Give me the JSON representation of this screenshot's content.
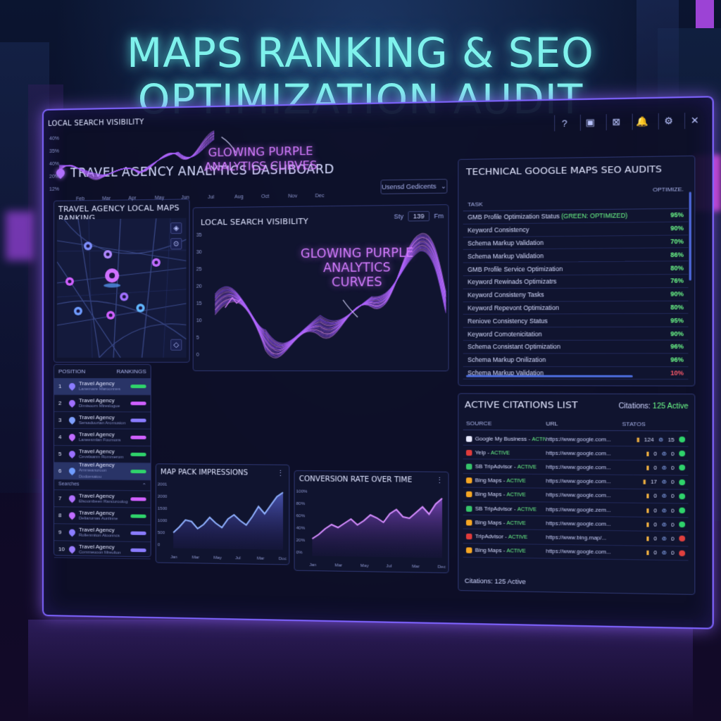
{
  "headline": [
    "MAPS RANKING & SEO",
    "OPTIMIZATION AUDIT"
  ],
  "toolbar": {
    "icons": [
      "help-icon",
      "book-icon",
      "edit-icon",
      "bell-icon",
      "gear-icon",
      "close-icon"
    ],
    "glyphs": [
      "?",
      "▣",
      "⊠",
      "🔔",
      "⚙",
      "✕"
    ]
  },
  "dashboard": {
    "title": "TRAVEL AGENCY ANALYTICS DASHBOARD",
    "dropdown": "Usensd Gedicents"
  },
  "maps_panel": {
    "title": "TRAVEL AGENCY LOCAL MAPS RANKING"
  },
  "lsv_top": {
    "title": "LOCAL SEARCH VISIBILITY",
    "range_prefix": "Sty",
    "range_value": "139",
    "range_suffix": "Fm",
    "y_ticks": [
      "35",
      "30",
      "25",
      "20",
      "15",
      "10",
      "5",
      "0"
    ],
    "annotation": [
      "GLOWING PURPLE",
      "ANALYTICS",
      "CURVES"
    ]
  },
  "ranking": {
    "col_position": "POSITION",
    "col_rankings": "RANKINGS",
    "divider": "Searches",
    "rows": [
      {
        "num": "1",
        "name": "Travel Agency",
        "sub": "Lanemare Maroonnes",
        "bar": "#2fd36b",
        "pin": "#8a7cff"
      },
      {
        "num": "2",
        "name": "Travel Agency",
        "sub": "Dimisoorn Mireslogue",
        "bar": "#d060ff",
        "pin": "#a070ff"
      },
      {
        "num": "3",
        "name": "Travel Agency",
        "sub": "Sersaduurtan Aromusion",
        "bar": "#8a7cff",
        "pin": "#7fa0ff"
      },
      {
        "num": "4",
        "name": "Travel Agency",
        "sub": "Laneesmlan Foumons",
        "bar": "#d060ff",
        "pin": "#c06cff"
      },
      {
        "num": "5",
        "name": "Travel Agency",
        "sub": "Cevelaanm Rommerom",
        "bar": "#2fd36b",
        "pin": "#9a70ff"
      },
      {
        "num": "6",
        "name": "Travel Agency",
        "sub": "Ammeanuroon Dodoesaiou",
        "bar": "#2fd36b",
        "pin": "#6f9cff"
      },
      {
        "num": "7",
        "name": "Travel Agency",
        "sub": "Elsoombeen Rancuroolog",
        "bar": "#d060ff",
        "pin": "#b070ff"
      },
      {
        "num": "8",
        "name": "Travel Agency",
        "sub": "Deliarumas Aunlinne",
        "bar": "#2fd36b",
        "pin": "#c06cff"
      },
      {
        "num": "9",
        "name": "Travel Agency",
        "sub": "Rollenmiton Aloonncs",
        "bar": "#8a7cff",
        "pin": "#8a7cff"
      },
      {
        "num": "10",
        "name": "Travel Agency",
        "sub": "Commeuoon Mreulton",
        "bar": "#8a7cff",
        "pin": "#9a7cff"
      }
    ]
  },
  "lsv_bottom": {
    "title": "LOCAL SEARCH VISIBILITY",
    "y_ticks": [
      "40%",
      "35%",
      "40%",
      "20%",
      "12%"
    ],
    "months": [
      "Feb",
      "Mar",
      "Apr",
      "May",
      "Jun",
      "Jul",
      "Aug",
      "Oct",
      "Nov",
      "Dec"
    ],
    "annotation": [
      "GLOWING PURPLE",
      "ANALYTICS CURVES"
    ]
  },
  "map_pack": {
    "title": "MAP PACK IMPRESSIONS",
    "y_ticks": [
      "2001",
      "2000",
      "1500",
      "1000",
      "500",
      "0"
    ],
    "months": [
      "Jan",
      "Mar",
      "May",
      "Jul",
      "Mar",
      "Doc"
    ]
  },
  "conversion": {
    "title": "CONVERSION RATE OVER TIME",
    "y_ticks": [
      "100%",
      "80%",
      "60%",
      "40%",
      "20%",
      "0%"
    ],
    "months": [
      "Jan",
      "Mar",
      "May",
      "Jul",
      "Mar",
      "Dec"
    ]
  },
  "audit": {
    "title": "TECHNICAL GOOGLE MAPS SEO AUDITS",
    "col_optimize": "OPTIMIZE.",
    "col_task": "TASK",
    "rows": [
      {
        "task": "GMB Profile Optimization Status",
        "tag": "(GREEN: OPTIMIZED)",
        "pct": "95%"
      },
      {
        "task": "Keyword Consistency",
        "tag": "",
        "pct": "90%"
      },
      {
        "task": "Schema Markup Validation",
        "tag": "",
        "pct": "70%"
      },
      {
        "task": "Schema Markup Validation",
        "tag": "",
        "pct": "86%"
      },
      {
        "task": "GMB Profile Service Optimization",
        "tag": "",
        "pct": "80%"
      },
      {
        "task": "Keyword Rewinads Optimizatrs",
        "tag": "",
        "pct": "76%"
      },
      {
        "task": "Keyword Consisteny Tasks",
        "tag": "",
        "pct": "90%"
      },
      {
        "task": "Keyword Repevont Optimization",
        "tag": "",
        "pct": "80%"
      },
      {
        "task": "Reniove Consistency Status",
        "tag": "",
        "pct": "95%"
      },
      {
        "task": "Keyword Comotenicitation",
        "tag": "",
        "pct": "90%"
      },
      {
        "task": "Schema Consistant Optimization",
        "tag": "",
        "pct": "96%"
      },
      {
        "task": "Schema Markup Onilization",
        "tag": "",
        "pct": "96%"
      },
      {
        "task": "Schema Markup Validation",
        "tag": "",
        "pct": "10%"
      }
    ]
  },
  "citations": {
    "title": "ACTIVE CITATIONS LIST",
    "count_label": "Citations:",
    "count_value": "125 Active",
    "col_source": "SOURCE",
    "col_url": "URL",
    "col_status": "STATOS",
    "footer": "Citations: 125 Active",
    "rows": [
      {
        "src": "Google My Business",
        "act": "ACTIVE",
        "url": "https://www.google.com...",
        "a": "124",
        "b": "15",
        "ok": true,
        "logo": "#e8eaff"
      },
      {
        "src": "Yelp",
        "act": "ACTIVE",
        "url": "https://www.google.com...",
        "a": "0",
        "b": "0",
        "ok": true,
        "logo": "#e03b3b"
      },
      {
        "src": "SB TripAdvisor",
        "act": "ACTIVE",
        "url": "https://www.google.com...",
        "a": "0",
        "b": "0",
        "ok": true,
        "logo": "#35c36a"
      },
      {
        "src": "Bing Maps",
        "act": "ACTIVE",
        "url": "https://www.google.com...",
        "a": "17",
        "b": "0",
        "ok": true,
        "logo": "#f5a623"
      },
      {
        "src": "Bing Maps",
        "act": "ACTIVE",
        "url": "https://www.google.com...",
        "a": "0",
        "b": "0",
        "ok": true,
        "logo": "#f5a623"
      },
      {
        "src": "SB TripAdvisor",
        "act": "ACTIVE",
        "url": "https://www.google.zem...",
        "a": "0",
        "b": "0",
        "ok": true,
        "logo": "#35c36a"
      },
      {
        "src": "Bing Maps",
        "act": "ACTIVE",
        "url": "https://www.google.com...",
        "a": "0",
        "b": "0",
        "ok": true,
        "logo": "#f5a623"
      },
      {
        "src": "TripAdvisor",
        "act": "ACTIVE",
        "url": "https://www.bing.map/...",
        "a": "0",
        "b": "0",
        "ok": false,
        "logo": "#e03b3b"
      },
      {
        "src": "Bing Maps",
        "act": "ACTIVE",
        "url": "https://www.google.com...",
        "a": "0",
        "b": "0",
        "ok": false,
        "logo": "#f5a623"
      }
    ]
  }
}
